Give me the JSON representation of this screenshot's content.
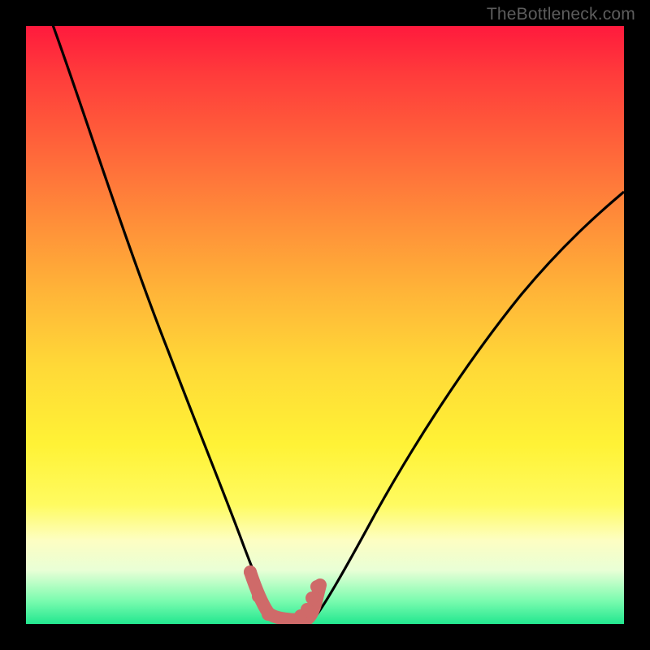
{
  "watermark": {
    "text": "TheBottleneck.com"
  },
  "colors": {
    "background": "#000000",
    "curve": "#000000",
    "marker": "#cf6a69",
    "gradient_top": "#ff1a3d",
    "gradient_bottom": "#22e78f"
  },
  "chart_data": {
    "type": "line",
    "title": "",
    "xlabel": "",
    "ylabel": "",
    "xlim": [
      0,
      100
    ],
    "ylim": [
      0,
      100
    ],
    "grid": false,
    "legend": false,
    "annotations": [
      "TheBottleneck.com"
    ],
    "series": [
      {
        "name": "left-curve",
        "x": [
          4,
          8,
          12,
          16,
          20,
          24,
          28,
          31,
          33,
          35,
          36,
          37,
          38,
          39,
          40,
          41
        ],
        "y": [
          100,
          88,
          76,
          64,
          53,
          42,
          32,
          24,
          19,
          14,
          11,
          8,
          5,
          3,
          1.5,
          0.5
        ]
      },
      {
        "name": "right-curve",
        "x": [
          48,
          50,
          53,
          57,
          62,
          68,
          74,
          80,
          86,
          92,
          98,
          100
        ],
        "y": [
          0.5,
          2,
          6,
          13,
          22,
          32,
          42,
          51,
          59,
          66,
          72,
          74
        ]
      },
      {
        "name": "trough-markers",
        "x": [
          37.5,
          38.8,
          40.5,
          43.5,
          46,
          47,
          47.8,
          48.6
        ],
        "y": [
          8,
          4,
          1,
          0.5,
          0.8,
          1.8,
          3.8,
          6
        ]
      }
    ]
  }
}
